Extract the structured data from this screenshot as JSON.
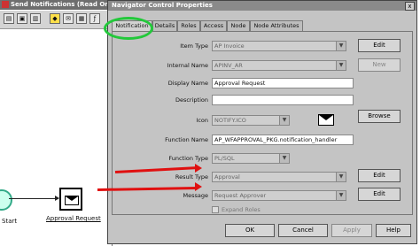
{
  "background_window": {
    "title": "Send Notifications (Read On",
    "start_label": "Start",
    "node_label": "Approval Request"
  },
  "dialog": {
    "title": "Navigator Control Properties",
    "close": "x",
    "tabs": [
      "Notification",
      "Details",
      "Roles",
      "Access",
      "Node",
      "Node Attributes"
    ],
    "active_tab": "Notification",
    "fields": {
      "item_type": {
        "label": "Item Type",
        "value": "AP Invoice"
      },
      "internal_name": {
        "label": "Internal Name",
        "value": "APINV_AR"
      },
      "display_name": {
        "label": "Display Name",
        "value": "Approval Request"
      },
      "description": {
        "label": "Description",
        "value": ""
      },
      "icon": {
        "label": "Icon",
        "value": "NOTIFY.ICO"
      },
      "function_name": {
        "label": "Function Name",
        "value": "AP_WFAPPROVAL_PKG.notification_handler"
      },
      "function_type": {
        "label": "Function Type",
        "value": "PL/SQL"
      },
      "result_type": {
        "label": "Result Type",
        "value": "Approval"
      },
      "message": {
        "label": "Message",
        "value": "Request Approver"
      }
    },
    "buttons": {
      "edit": "Edit",
      "new": "New",
      "browse": "Browse",
      "ok": "OK",
      "cancel": "Cancel",
      "apply": "Apply",
      "help": "Help"
    },
    "expand_roles_label": "Expand Roles",
    "icons": [
      "envelope-icon"
    ]
  },
  "annotations": {
    "highlight_color": "#22c83a",
    "arrow_color": "#e01010"
  }
}
